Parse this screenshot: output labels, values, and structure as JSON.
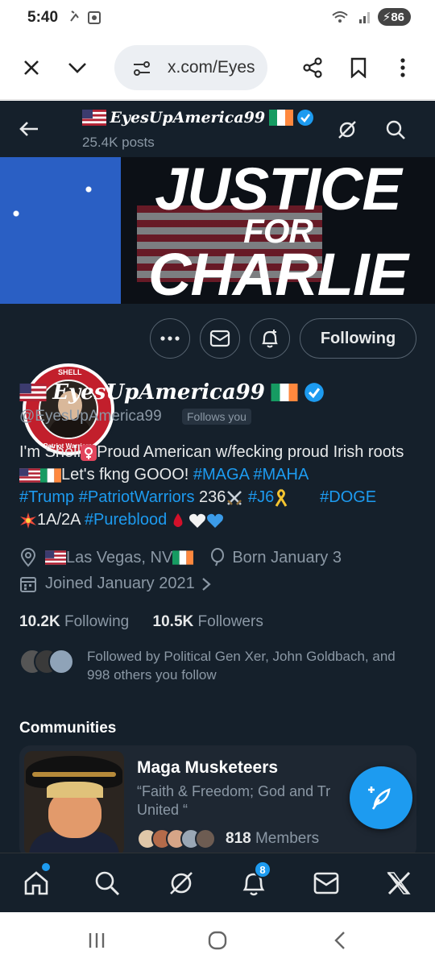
{
  "status_bar": {
    "time": "5:40",
    "battery": "86"
  },
  "browser": {
    "url": "x.com/Eyes"
  },
  "profile": {
    "display_name": "EyesUpAmerica99",
    "posts_count": "25.4K posts",
    "handle": "@EyesUpAmerica99",
    "follows_you": "Follows you",
    "banner_line1": "JUSTICE",
    "banner_line2": "FOR",
    "banner_line3": "CHARLIE",
    "avatar_top_text": "SHELL",
    "avatar_ring_text": "Patriot Warriors",
    "following_button": "Following",
    "bio": {
      "t1": "I'm Shell",
      "t2": "Proud American w/fecking proud Irish roots",
      "t3": "Let's fkng GOOO! ",
      "tag_maga": "#MAGA",
      "tag_maha": "#MAHA",
      "tag_trump": "#Trump",
      "tag_pw": "#PatriotWarriors",
      "t4": " 236",
      "tag_j6": "#J6",
      "tag_doge": "#DOGE",
      "t5": "1A/2A ",
      "tag_pureblood": "#Pureblood"
    },
    "location": "Las Vegas, NV",
    "birthday": "Born January 3",
    "joined": "Joined January 2021",
    "following_count": "10.2K",
    "following_label": "Following",
    "followers_count": "10.5K",
    "followers_label": "Followers",
    "followed_by": "Followed by Political Gen Xer, John Goldbach, and 998 others you follow"
  },
  "communities": {
    "title": "Communities",
    "items": [
      {
        "name": "Maga Musketeers",
        "description": "“Faith & Freedom; God and Tr United “",
        "members_count": "818",
        "members_label": "Members"
      }
    ]
  },
  "tabbar": {
    "notifications_badge": "8"
  },
  "colors": {
    "background": "#15202b",
    "accent": "#1d9bf0",
    "text": "#e7e9ea",
    "muted": "#8b98a5"
  }
}
